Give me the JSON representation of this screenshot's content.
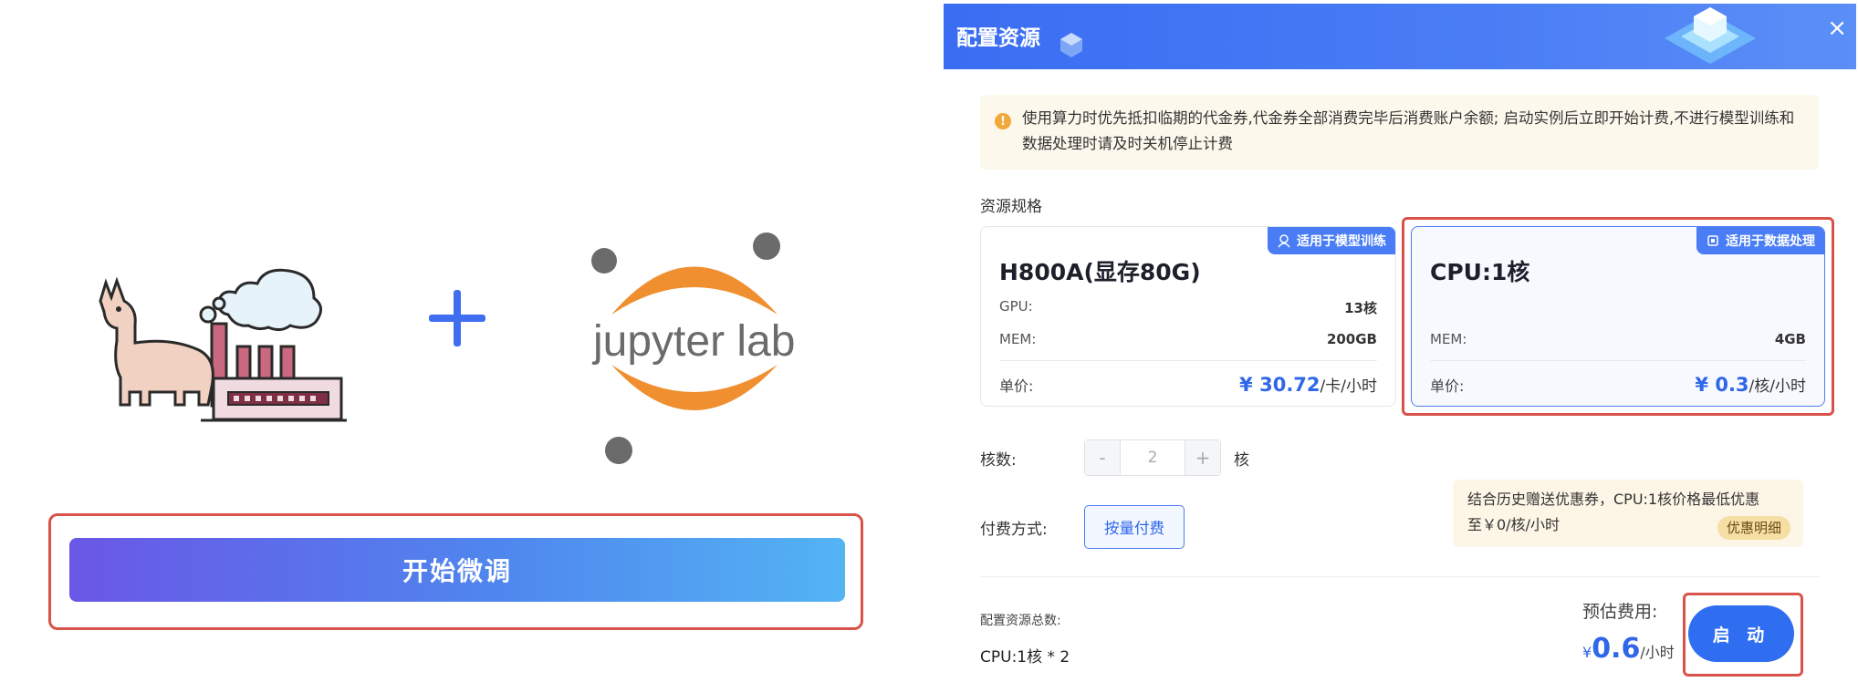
{
  "left": {
    "plus": "+",
    "jupyter_text": "jupyter lab",
    "start_button": "开始微调"
  },
  "dialog": {
    "title": "配置资源",
    "close": "×",
    "notice": "使用算力时优先抵扣临期的代金券,代金券全部消费完毕后消费账户余额; 启动实例后立即开始计费,不进行模型训练和数据处理时请及时关机停止计费",
    "spec_label": "资源规格",
    "cards": [
      {
        "tag": "适用于模型训练",
        "title": "H800A(显存80G)",
        "gpu_label": "GPU:",
        "gpu_value": "13核",
        "mem_label": "MEM:",
        "mem_value": "200GB",
        "price_label": "单价:",
        "price_currency": "¥ ",
        "price_value": "30.72",
        "price_unit": "/卡/小时"
      },
      {
        "tag": "适用于数据处理",
        "title": "CPU:1核",
        "mem_label": "MEM:",
        "mem_value": "4GB",
        "price_label": "单价:",
        "price_currency": "¥ ",
        "price_value": "0.3",
        "price_unit": "/核/小时",
        "selected": true
      }
    ],
    "cores_label": "核数:",
    "cores_value": "2",
    "cores_unit": "核",
    "minus": "-",
    "plus": "+",
    "pay_label": "付费方式:",
    "pay_button": "按量付费",
    "promo_line1": "结合历史赠送优惠券，CPU:1核价格最低优惠",
    "promo_line2": "至￥0/核/小时",
    "promo_detail": "优惠明细",
    "total_label": "配置资源总数:",
    "total_value": "CPU:1核 * 2",
    "est_label": "预估费用:",
    "est_currency": "¥",
    "est_value": "0.6",
    "est_unit": "/小时",
    "launch_button": "启 动"
  },
  "colors": {
    "accent": "#2f6ef0",
    "highlight": "#d9534a",
    "jupyter_orange": "#f08f30"
  }
}
